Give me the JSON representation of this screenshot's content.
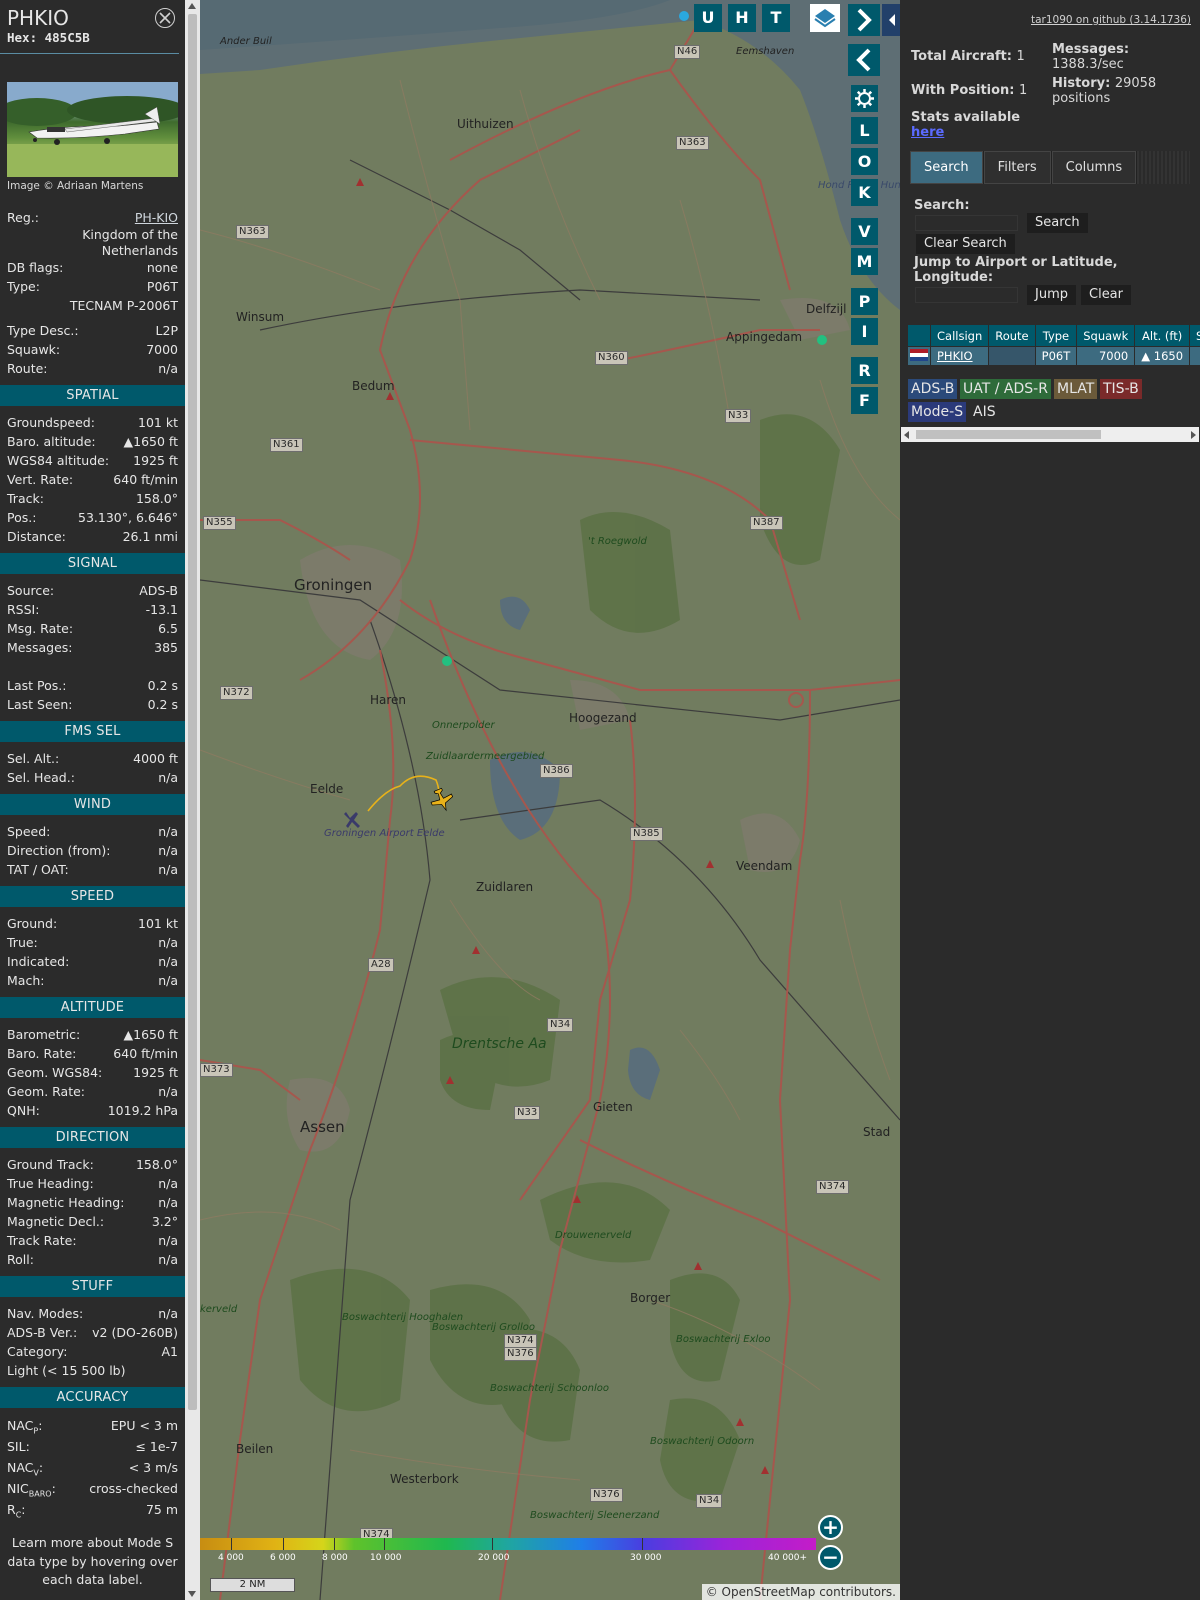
{
  "info": {
    "callsign": "PHKIO",
    "hex": "Hex: 485C5B",
    "photo_credit": "Image © Adriaan Martens",
    "reg_label": "Reg.:",
    "reg_value": "PH-KIO",
    "country": "Kingdom of the Netherlands",
    "rows_basic": [
      {
        "k": "DB flags:",
        "v": "none"
      },
      {
        "k": "Type:",
        "v": "P06T"
      }
    ],
    "type_full": "TECNAM P-2006T",
    "rows_basic2": [
      {
        "k": "Type Desc.:",
        "v": "L2P"
      },
      {
        "k": "Squawk:",
        "v": "7000"
      },
      {
        "k": "Route:",
        "v": "n/a"
      }
    ],
    "sections": [
      {
        "title": "SPATIAL",
        "rows": [
          {
            "k": "Groundspeed:",
            "v": "101 kt"
          },
          {
            "k": "Baro. altitude:",
            "v": "▲1650 ft"
          },
          {
            "k": "WGS84 altitude:",
            "v": "1925 ft"
          },
          {
            "k": "Vert. Rate:",
            "v": "640 ft/min"
          },
          {
            "k": "Track:",
            "v": "158.0°"
          },
          {
            "k": "Pos.:",
            "v": "53.130°, 6.646°"
          },
          {
            "k": "Distance:",
            "v": "26.1 nmi"
          }
        ]
      },
      {
        "title": "SIGNAL",
        "rows": [
          {
            "k": "Source:",
            "v": "ADS-B"
          },
          {
            "k": "RSSI:",
            "v": "-13.1"
          },
          {
            "k": "Msg. Rate:",
            "v": "6.5"
          },
          {
            "k": "Messages:",
            "v": "385"
          },
          {
            "k": "",
            "v": ""
          },
          {
            "k": "Last Pos.:",
            "v": "0.2 s"
          },
          {
            "k": "Last Seen:",
            "v": "0.2 s"
          }
        ]
      },
      {
        "title": "FMS SEL",
        "rows": [
          {
            "k": "Sel. Alt.:",
            "v": "4000 ft"
          },
          {
            "k": "Sel. Head.:",
            "v": "n/a"
          }
        ]
      },
      {
        "title": "WIND",
        "rows": [
          {
            "k": "Speed:",
            "v": "n/a"
          },
          {
            "k": "Direction (from):",
            "v": "n/a"
          },
          {
            "k": "TAT / OAT:",
            "v": "n/a"
          }
        ]
      },
      {
        "title": "SPEED",
        "rows": [
          {
            "k": "Ground:",
            "v": "101 kt"
          },
          {
            "k": "True:",
            "v": "n/a"
          },
          {
            "k": "Indicated:",
            "v": "n/a"
          },
          {
            "k": "Mach:",
            "v": "n/a"
          }
        ]
      },
      {
        "title": "ALTITUDE",
        "rows": [
          {
            "k": "Barometric:",
            "v": "▲1650 ft"
          },
          {
            "k": "Baro. Rate:",
            "v": "640 ft/min"
          },
          {
            "k": "Geom. WGS84:",
            "v": "1925 ft"
          },
          {
            "k": "Geom. Rate:",
            "v": "n/a"
          },
          {
            "k": "QNH:",
            "v": "1019.2 hPa"
          }
        ]
      },
      {
        "title": "DIRECTION",
        "rows": [
          {
            "k": "Ground Track:",
            "v": "158.0°"
          },
          {
            "k": "True Heading:",
            "v": "n/a"
          },
          {
            "k": "Magnetic Heading:",
            "v": "n/a"
          },
          {
            "k": "Magnetic Decl.:",
            "v": "3.2°"
          },
          {
            "k": "Track Rate:",
            "v": "n/a"
          },
          {
            "k": "Roll:",
            "v": "n/a"
          }
        ]
      },
      {
        "title": "STUFF",
        "rows": [
          {
            "k": "Nav. Modes:",
            "v": "n/a"
          },
          {
            "k": "ADS-B Ver.:",
            "v": "v2 (DO-260B)"
          },
          {
            "k": "Category:",
            "v": "A1"
          }
        ],
        "extra": "Light (< 15 500 lb)"
      }
    ],
    "accuracy_title": "ACCURACY",
    "accuracy": {
      "nacp_k": "NAC",
      "nacp_sub": "P",
      "nacp_v": "EPU < 3 m",
      "sil_k": "SIL:",
      "sil_v": "≤ 1e-7",
      "nacv_k": "NAC",
      "nacv_sub": "V",
      "nacv_v": "< 3 m/s",
      "nicb_k": "NIC",
      "nicb_sub": "BARO",
      "nicb_v": "cross-checked",
      "rc_k": "R",
      "rc_sub": "C",
      "rc_v": "75 m"
    },
    "footer": "Learn more about Mode S data type by hovering over each data label."
  },
  "map": {
    "top_buttons": [
      "U",
      "H",
      "T"
    ],
    "side_buttons": [
      "L",
      "O",
      "K",
      "V",
      "M",
      "P",
      "I",
      "R",
      "F"
    ],
    "places": {
      "groningen": "Groningen",
      "hoogezand": "Hoogezand",
      "assen": "Assen",
      "haren": "Haren",
      "eelde": "Eelde",
      "zuidlaren": "Zuidlaren",
      "veendam": "Veendam",
      "gieten": "Gieten",
      "borger": "Borger",
      "beilen": "Beilen",
      "westerbork": "Westerbork",
      "bedum": "Bedum",
      "winsum": "Winsum",
      "uithuizen": "Uithuizen",
      "appingedam": "Appingedam",
      "delfzijl": "Delfzijl",
      "eemshaven": "Eemshaven",
      "anderbuil": "Ander Buil",
      "stad": "Stad",
      "drentsche": "Drentsche Aa",
      "airport": "Groningen Airport Eelde",
      "onnerpolder": "Onnerpolder",
      "zuidlaardermeer": "Zuidlaardermeergebied",
      "roegwold": "'t Roegwold",
      "drouwenerveld": "Drouwenerveld",
      "hooghalen": "Boswachterij Hooghalen",
      "grolloo": "Boswachterij Grolloo",
      "schoonloo": "Boswachterij Schoonloo",
      "exloo": "Boswachterij Exloo",
      "odoorn": "Boswachterij Odoorn",
      "sleenerzand": "Boswachterij Sleenerzand",
      "hond": "Hond Paapz Hund und",
      "kerveld": "kerveld"
    },
    "roads": {
      "n46": "N46",
      "n363a": "N363",
      "n363b": "N363",
      "n360": "N360",
      "n33a": "N33",
      "n361": "N361",
      "n355": "N355",
      "n387": "N387",
      "n372": "N372",
      "n386": "N386",
      "n385": "N385",
      "a28": "A28",
      "n34a": "N34",
      "n373": "N373",
      "n33b": "N33",
      "n374a": "N374",
      "n374b": "N374",
      "n376a": "N376",
      "n376b": "N376",
      "n34b": "N34",
      "n374c": "N374"
    },
    "colorbar_labels": [
      "4 000",
      "6 000",
      "8 000",
      "10 000",
      "20 000",
      "30 000",
      "40 000+"
    ],
    "scale": "2 NM",
    "attribution_prefix": "© ",
    "attribution_link": "OpenStreetMap",
    "attribution_suffix": " contributors.",
    "zoom_in": "+",
    "zoom_out": "−"
  },
  "side": {
    "github": "tar1090 on github (3.14.1736)",
    "total_aircraft_label": "Total Aircraft:",
    "total_aircraft": "1",
    "with_position_label": "With Position:",
    "with_position": "1",
    "stats_label": "Stats available",
    "stats_link": "here",
    "messages_label": "Messages:",
    "messages_value": "1388.3/sec",
    "history_label": "History:",
    "history_value": "29058",
    "history_unit": "positions",
    "tabs": [
      "Search",
      "Filters",
      "Columns"
    ],
    "search_label": "Search:",
    "search_button": "Search",
    "clear_search": "Clear Search",
    "jump_label": "Jump to Airport or Latitude, Longitude:",
    "jump_button": "Jump",
    "clear_button": "Clear",
    "table": {
      "headers": [
        "",
        "Callsign",
        "Route",
        "Type",
        "Squawk",
        "Alt. (ft)",
        "Spd"
      ],
      "row": {
        "callsign": "PHKIO",
        "route": "",
        "type": "P06T",
        "squawk": "7000",
        "alt": "▲ 1650",
        "spd": ""
      }
    },
    "sources": [
      "ADS-B",
      "UAT / ADS-R",
      "MLAT",
      "TIS-B",
      "Mode-S",
      "AIS"
    ],
    "source_colors": [
      "#2b4a7a",
      "#2e6b3a",
      "#6b5a3a",
      "#7a2a2a",
      "#2b3a7a",
      "#2b2b2b"
    ]
  }
}
